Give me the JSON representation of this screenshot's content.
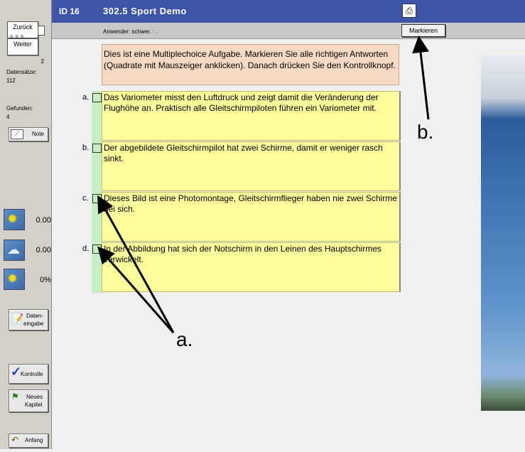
{
  "header": {
    "id_label": "ID 16",
    "title": "302.5 Sport Demo",
    "print_icon": "printer-icon"
  },
  "subbar": {
    "user": "Anwender: schwer. : .",
    "mark_label": "Markieren"
  },
  "sidebar": {
    "back_label": "Zurück",
    "forward_label": "Weiter",
    "nav_count": "2",
    "records_label": "Datensätze:",
    "records_value": "112",
    "found_label": "Gefunden:",
    "found_value": "4",
    "note_label": "Note",
    "weather": [
      {
        "icon": "sun-icon",
        "value": "0.00"
      },
      {
        "icon": "cloud-icon",
        "value": "0.00"
      },
      {
        "icon": "sun-cloud-icon",
        "value": "0%"
      }
    ],
    "data_entry_label_1": "Daten-",
    "data_entry_label_2": "eingabe",
    "check_label": "Kontrolle",
    "new_chapter_label_1": "Neues",
    "new_chapter_label_2": "Kapitel",
    "start_label": "Anfang"
  },
  "instructions": "Dies ist eine Multiplechoice Aufgabe. Markieren Sie alle richtigen Antworten (Quadrate mit Mauszeiger anklicken). Danach drücken Sie den Kontrollknopf.",
  "answers": [
    {
      "letter": "a.",
      "text": "Das Variometer misst den Luftdruck und zeigt damit die Veränderung der Flughöhe an. Praktisch alle Gleitschirmpiloten führen ein Variometer mit."
    },
    {
      "letter": "b.",
      "text": "Der abgebildete Gleitschirmpilot hat zwei Schirme, damit er weniger rasch sinkt."
    },
    {
      "letter": "c.",
      "text": "Dieses Bild ist eine Photomontage, Gleitschirmflieger haben nie zwei Schirme bei sich."
    },
    {
      "letter": "d.",
      "text": "In der Abbildung hat sich der Notschirm in den Leinen des Hauptschirmes verwickelt."
    }
  ],
  "annotations": {
    "a": "a.",
    "b": "b."
  }
}
